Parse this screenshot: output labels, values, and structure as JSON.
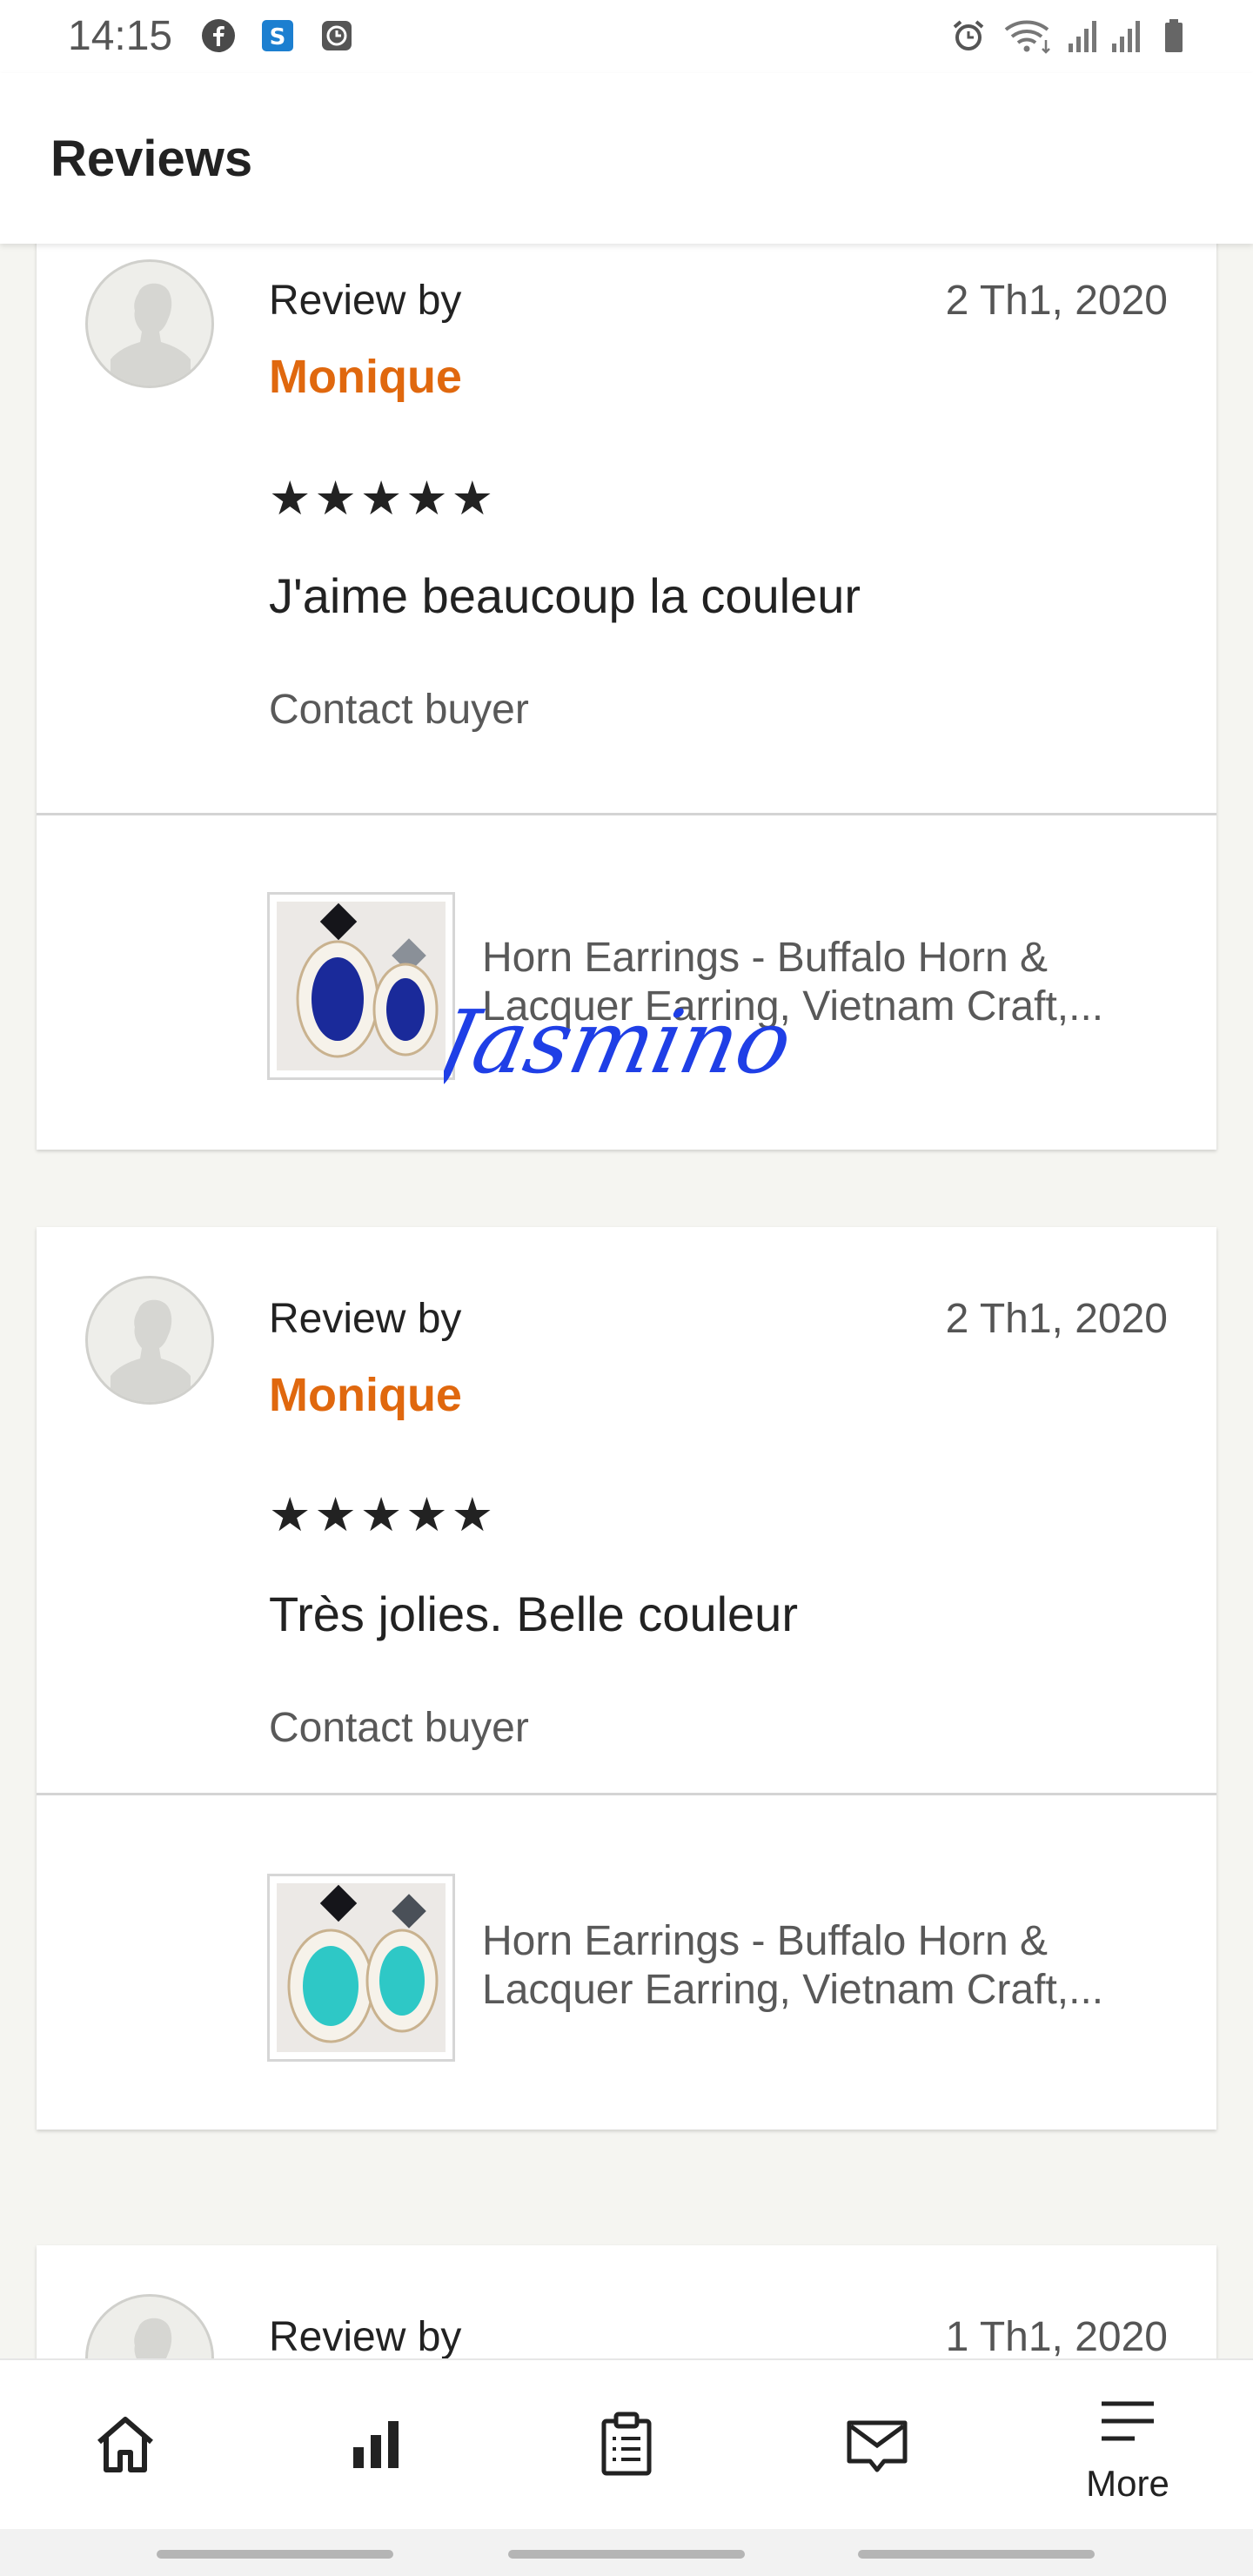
{
  "status_bar": {
    "time": "14:15",
    "left_icons": [
      "facebook-icon",
      "skype-icon",
      "clock-app-icon"
    ],
    "right_icons": [
      "alarm-icon",
      "wifi-icon",
      "signal-icon",
      "signal-icon",
      "battery-icon"
    ]
  },
  "header": {
    "title": "Reviews"
  },
  "reviews": [
    {
      "review_by": "Review by",
      "reviewer": "Monique",
      "date": "2 Th1, 2020",
      "stars": "★★★★★",
      "rating": 5,
      "text": "J'aime beaucoup la couleur",
      "contact": "Contact buyer",
      "listing_line1": "Horn Earrings - Buffalo Horn &",
      "listing_line2": "Lacquer Earring, Vietnam Craft,...",
      "earring_color": "#1a2a9a"
    },
    {
      "review_by": "Review by",
      "reviewer": "Monique",
      "date": "2 Th1, 2020",
      "stars": "★★★★★",
      "rating": 5,
      "text": "Très jolies. Belle couleur",
      "contact": "Contact buyer",
      "listing_line1": "Horn Earrings - Buffalo Horn &",
      "listing_line2": "Lacquer Earring, Vietnam Craft,...",
      "earring_color": "#2ec8c6"
    },
    {
      "review_by": "Review by",
      "date": "1 Th1, 2020"
    }
  ],
  "signature": "Jasmino",
  "bottom_nav": {
    "items": [
      "home-icon",
      "stats-icon",
      "orders-icon",
      "messages-icon",
      "menu-icon"
    ],
    "more_label": "More"
  },
  "colors": {
    "accent_orange": "#e0680e",
    "signature_blue": "#1f3fe6",
    "background": "#f5f5f1"
  }
}
